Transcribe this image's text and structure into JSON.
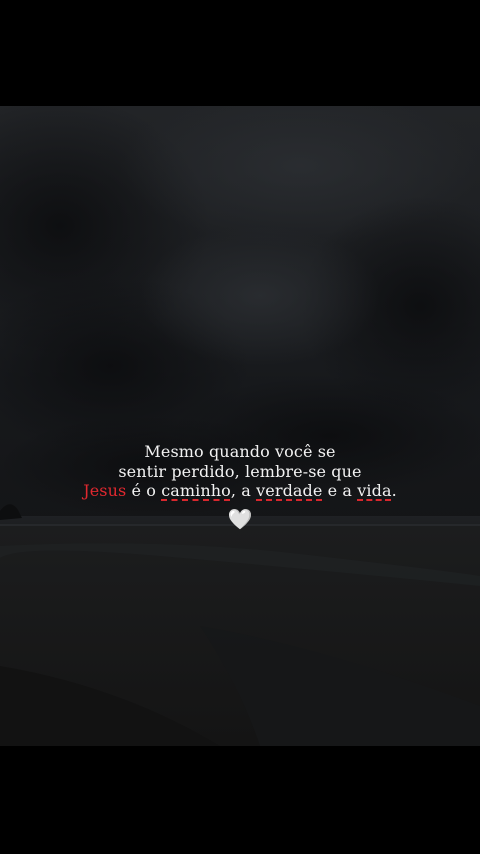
{
  "caption": {
    "line1": "Mesmo quando você se",
    "line2": "sentir perdido, lembre-se que",
    "line3": {
      "jesus": "Jesus",
      "part1": " é o ",
      "caminho": "caminho",
      "part2": ", a ",
      "verdade": "verdade",
      "part3": " e a ",
      "vida": "vida",
      "part4": "."
    }
  },
  "heart": {
    "symbol": "🤍",
    "icon": "white-heart-icon"
  },
  "colors": {
    "accent": "#e0282f",
    "text": "#f2f2f2",
    "background": "#000000"
  }
}
